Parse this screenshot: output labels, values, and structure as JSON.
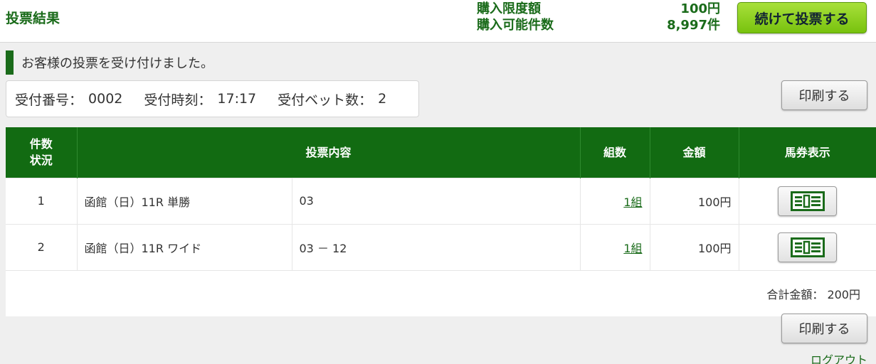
{
  "header": {
    "title": "投票結果",
    "limit_label": "購入限度額",
    "limit_value": "100円",
    "available_label": "購入可能件数",
    "available_value": "8,997件",
    "continue_button": "続けて投票する"
  },
  "notice": "お客様の投票を受け付けました。",
  "receipt": {
    "number_label": "受付番号：",
    "number_value": "0002",
    "time_label": "受付時刻：",
    "time_value": "17:17",
    "bets_label": "受付ベット数：",
    "bets_value": "2"
  },
  "print_button": "印刷する",
  "table": {
    "headers": {
      "count_line1": "件数",
      "count_line2": "状況",
      "content": "投票内容",
      "combos": "組数",
      "amount": "金額",
      "ticket": "馬券表示"
    },
    "rows": [
      {
        "no": "1",
        "race": "函館（日）11R 単勝",
        "selection": "03",
        "combos": "1組",
        "amount": "100円"
      },
      {
        "no": "2",
        "race": "函館（日）11R ワイド",
        "selection": "03 － 12",
        "combos": "1組",
        "amount": "100円"
      }
    ],
    "total": "合計金額： 200円"
  },
  "logout": "ログアウト",
  "colors": {
    "brand_green": "#1a6b1a",
    "header_green": "#126b12",
    "continue_green": "#78c20e",
    "total_bg": "#f4fbe9"
  },
  "icons": {
    "ticket": "ticket-view-icon"
  }
}
